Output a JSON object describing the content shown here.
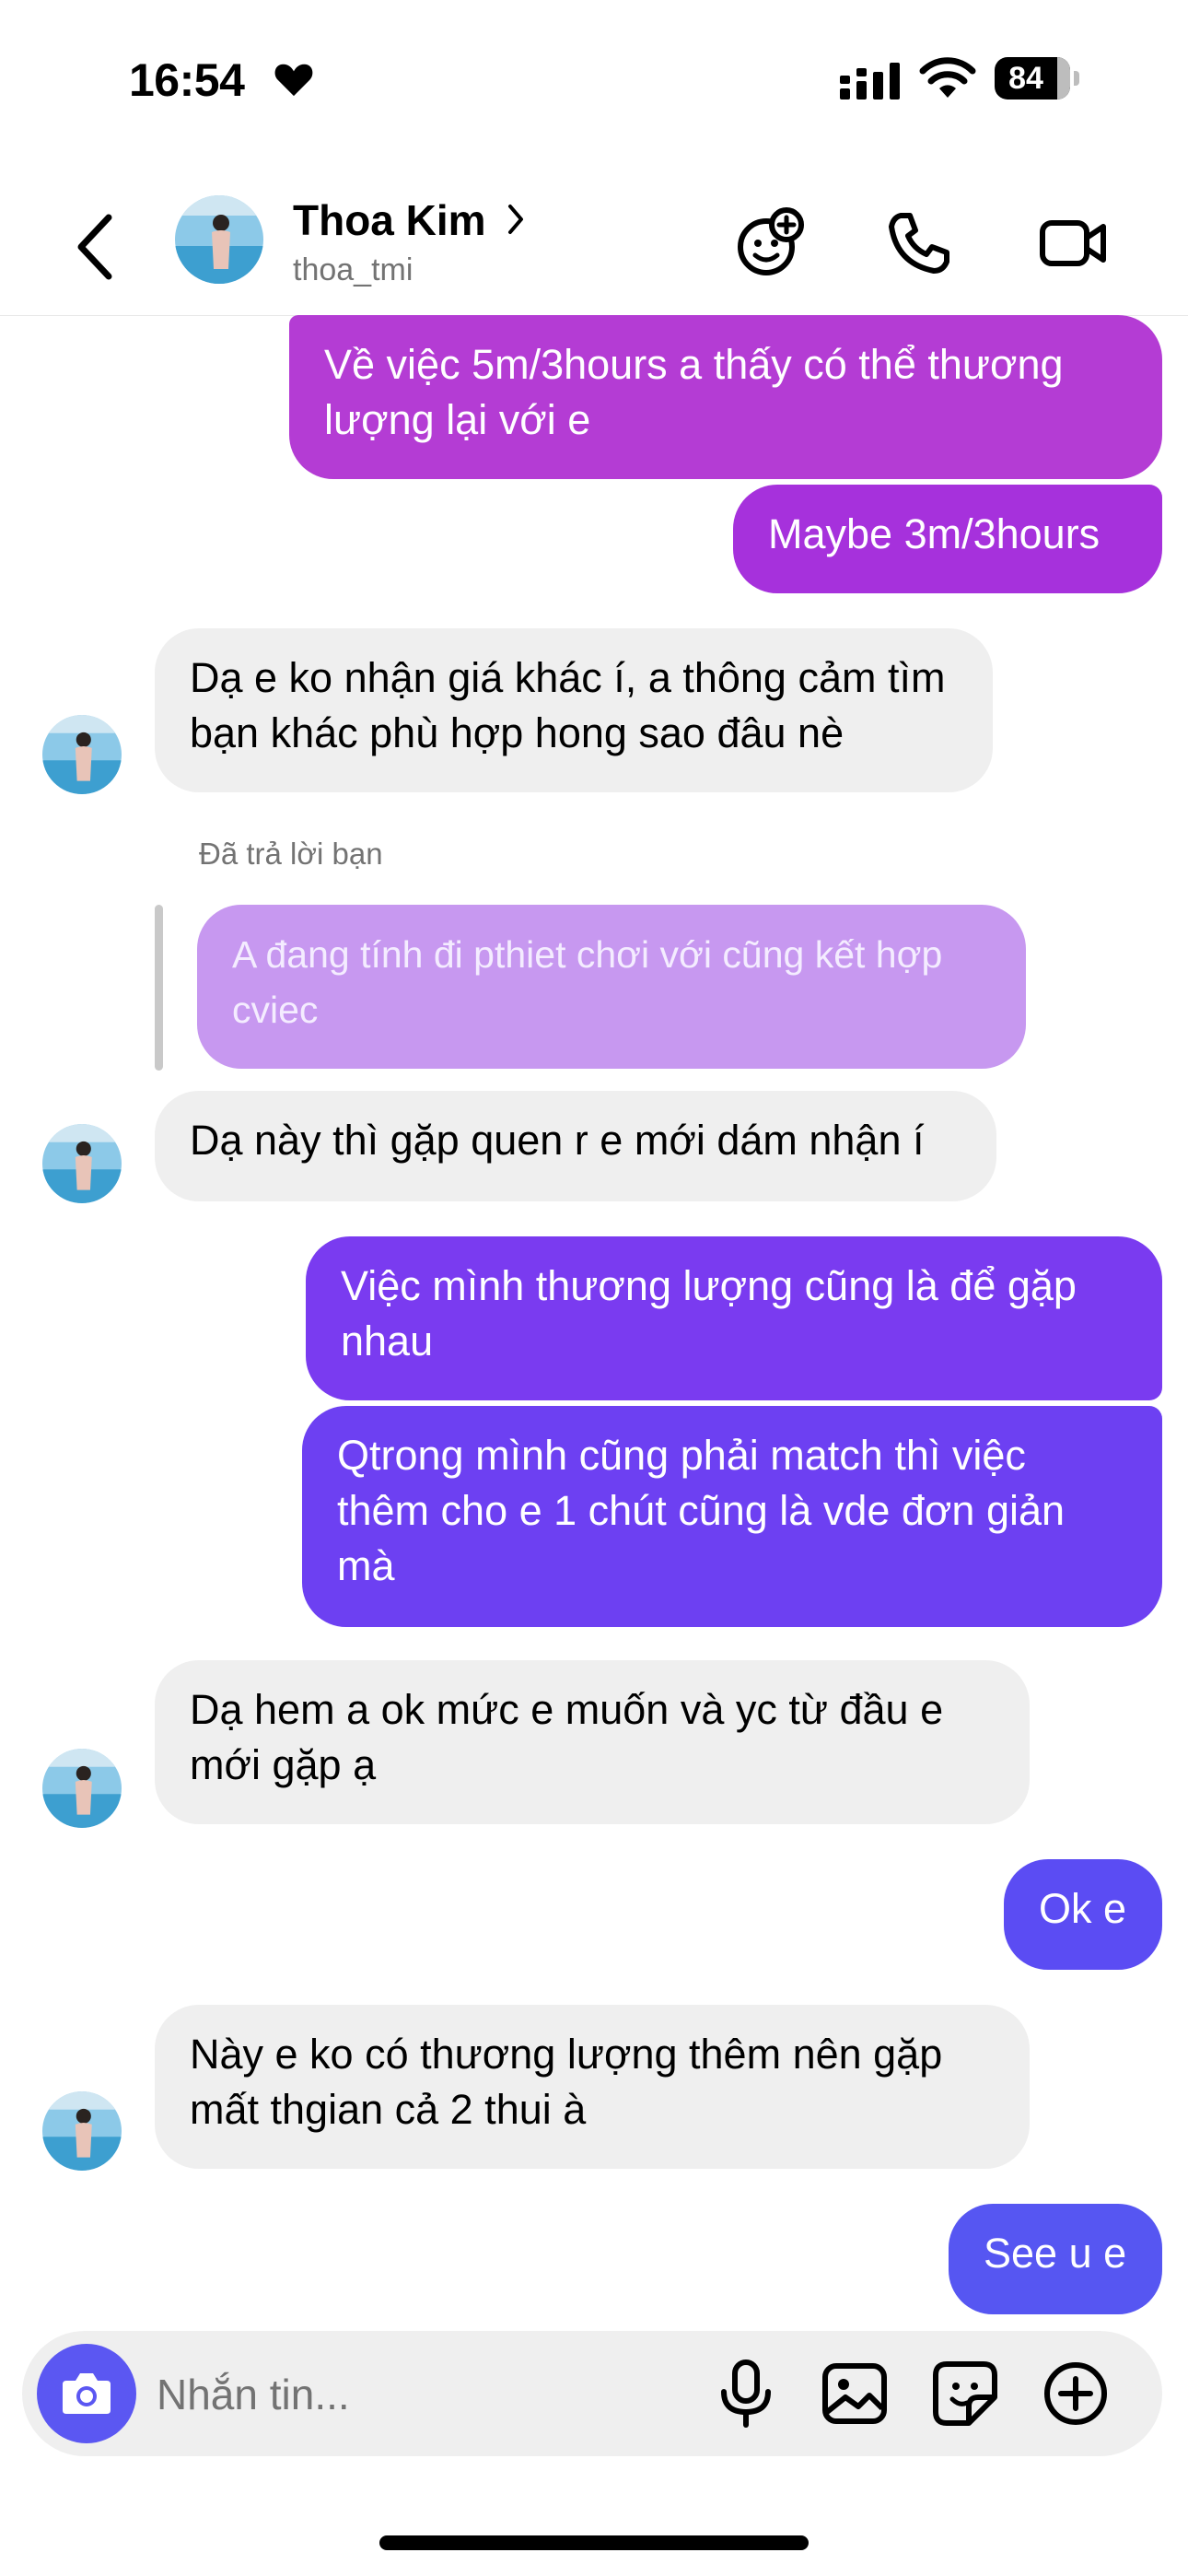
{
  "status_bar": {
    "time": "16:54",
    "battery": "84"
  },
  "header": {
    "name": "Thoa Kim",
    "handle": "thoa_tmi"
  },
  "colors": {
    "outgoing_gradient": [
      "#b23ad8",
      "#5a4df5"
    ],
    "incoming_bubble": "#efefef",
    "quoted_bubble": "#c798f0",
    "accent": "#5b57f2"
  },
  "messages": [
    {
      "dir": "out",
      "text": "Về việc 5m/3hours a thấy có thể thương lượng lại với e"
    },
    {
      "dir": "out",
      "text": "Maybe 3m/3hours"
    },
    {
      "dir": "in",
      "text": "Dạ e ko nhận giá khác í, a thông cảm tìm bạn khác phù hợp hong sao đâu nè"
    },
    {
      "dir": "in",
      "reply_label": "Đã trả lời bạn",
      "quoted": "A đang tính đi pthiet chơi với cũng kết hợp cviec",
      "text": "Dạ này thì gặp quen r e mới dám nhận í"
    },
    {
      "dir": "out",
      "text": "Việc mình thương lượng cũng là để gặp nhau"
    },
    {
      "dir": "out",
      "text": "Qtrong mình cũng phải match thì việc thêm cho e 1 chút cũng là vde đơn giản mà"
    },
    {
      "dir": "in",
      "text": "Dạ hem a ok mức e muốn và yc từ đầu e mới gặp ạ"
    },
    {
      "dir": "out",
      "text": "Ok e"
    },
    {
      "dir": "in",
      "text": "Này e ko có thương lượng thêm nên gặp mất thgian cả 2 thui à"
    },
    {
      "dir": "out",
      "text": "See u e"
    }
  ],
  "composer": {
    "placeholder": "Nhắn tin..."
  }
}
